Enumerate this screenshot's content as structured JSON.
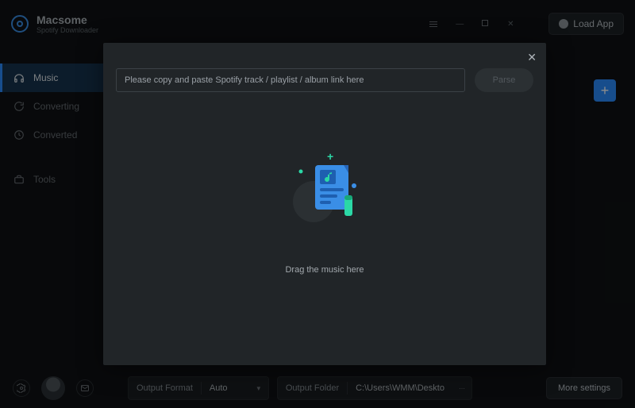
{
  "brand": {
    "name": "Macsome",
    "sub": "Spotify Downloader"
  },
  "titlebar": {
    "load_app": "Load App"
  },
  "sidebar": {
    "items": [
      {
        "label": "Music"
      },
      {
        "label": "Converting"
      },
      {
        "label": "Converted"
      },
      {
        "label": "Tools"
      }
    ]
  },
  "modal": {
    "url_placeholder": "Please copy and paste Spotify track / playlist / album link here",
    "parse_label": "Parse",
    "drop_caption": "Drag the music here"
  },
  "bottombar": {
    "output_format_label": "Output Format",
    "output_format_value": "Auto",
    "output_folder_label": "Output Folder",
    "output_folder_value": "C:\\Users\\WMM\\Deskto",
    "more_settings": "More settings"
  }
}
